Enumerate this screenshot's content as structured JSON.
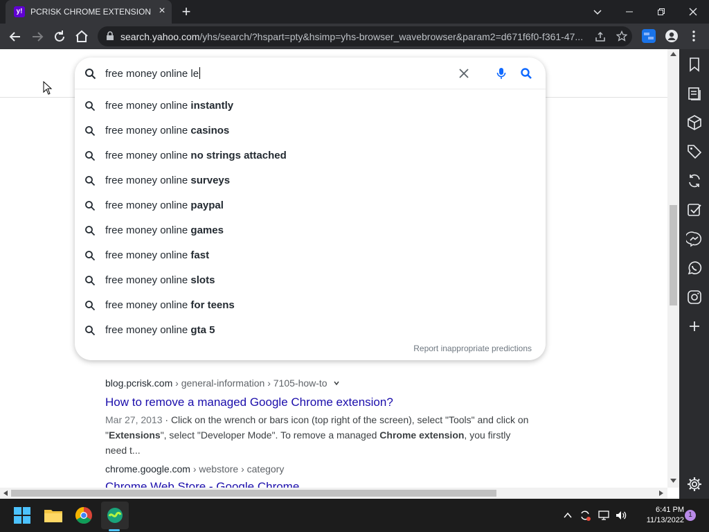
{
  "browser": {
    "tab_title": "PCRISK CHROME EXTENSION - Y",
    "favicon_text": "y!",
    "url_host": "search.yahoo.com",
    "url_path": "/yhs/search/?hspart=pty&hsimp=yhs-browser_wavebrowser&param2=d671f6f0-f361-47..."
  },
  "search": {
    "query": "free money online le",
    "suggestions": [
      {
        "prefix": "free money online ",
        "bold": "instantly"
      },
      {
        "prefix": "free money online ",
        "bold": "casinos"
      },
      {
        "prefix": "free money online ",
        "bold": "no strings attached"
      },
      {
        "prefix": "free money online ",
        "bold": "surveys"
      },
      {
        "prefix": "free money online ",
        "bold": "paypal"
      },
      {
        "prefix": "free money online ",
        "bold": "games"
      },
      {
        "prefix": "free money online ",
        "bold": "fast"
      },
      {
        "prefix": "free money online ",
        "bold": "slots"
      },
      {
        "prefix": "free money online ",
        "bold": "for teens"
      },
      {
        "prefix": "free money online ",
        "bold": "gta 5"
      }
    ],
    "report_label": "Report inappropriate predictions"
  },
  "results": [
    {
      "host": "blog.pcrisk.com",
      "crumb": " › general-information › 7105-how-to",
      "title": "How to remove a managed Google Chrome extension?",
      "date": "Mar 27, 2013",
      "snippet_1": " · Click on the wrench or bars icon (top right of the screen), select \"Tools\" and click on",
      "snippet_2a": "\"",
      "snippet_2b": "Extensions",
      "snippet_2c": "\", select \"Developer Mode\". To remove a managed ",
      "snippet_2d": "Chrome extension",
      "snippet_2e": ", you firstly need t..."
    },
    {
      "host": "chrome.google.com",
      "crumb": " › webstore › category",
      "title": "Chrome Web Store - Google Chrome"
    }
  ],
  "taskbar": {
    "time": "6:41 PM",
    "date": "11/13/2022",
    "notification_count": "1"
  },
  "colors": {
    "accent_purple": "#6001d2",
    "link_blue": "#1a0dab",
    "search_blue": "#0f69ff"
  }
}
